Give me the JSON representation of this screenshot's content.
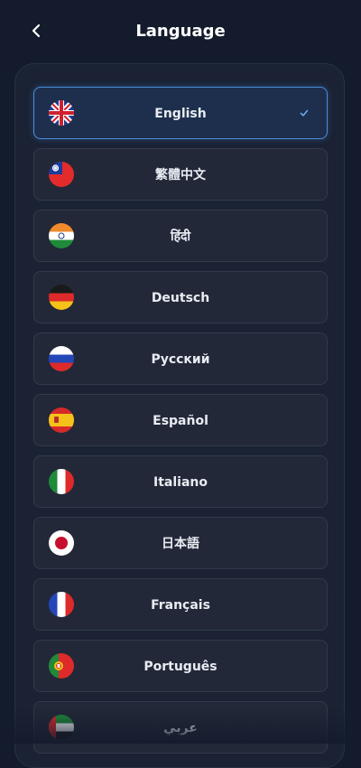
{
  "header": {
    "title": "Language",
    "back_icon": "chevron-left-icon"
  },
  "colors": {
    "accent": "#4a8cdc",
    "background": "#131b2c",
    "item_bg": "#222838"
  },
  "languages": [
    {
      "label": "English",
      "flag": "uk-flag-icon",
      "selected": true
    },
    {
      "label": "繁體中文",
      "flag": "taiwan-flag-icon",
      "selected": false
    },
    {
      "label": "हिंदी",
      "flag": "india-flag-icon",
      "selected": false
    },
    {
      "label": "Deutsch",
      "flag": "germany-flag-icon",
      "selected": false
    },
    {
      "label": "Русский",
      "flag": "russia-flag-icon",
      "selected": false
    },
    {
      "label": "Español",
      "flag": "spain-flag-icon",
      "selected": false
    },
    {
      "label": "Italiano",
      "flag": "italy-flag-icon",
      "selected": false
    },
    {
      "label": "日本語",
      "flag": "japan-flag-icon",
      "selected": false
    },
    {
      "label": "Français",
      "flag": "france-flag-icon",
      "selected": false
    },
    {
      "label": "Português",
      "flag": "portugal-flag-icon",
      "selected": false
    },
    {
      "label": "عربي",
      "flag": "uae-flag-icon",
      "selected": false
    }
  ]
}
